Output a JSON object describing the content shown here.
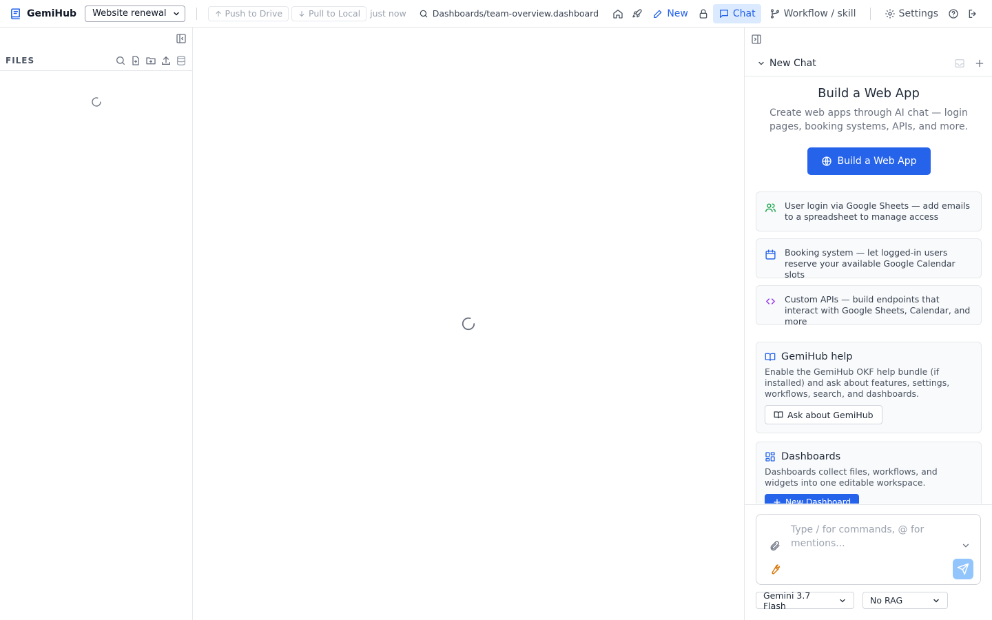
{
  "app": {
    "name": "GemiHub",
    "brand_color": "#2563eb"
  },
  "topbar": {
    "workspace": "Website renewal",
    "push_label": "Push to Drive",
    "pull_label": "Pull to Local",
    "sync_time": "just now",
    "file_path": "Dashboards/team-overview.dashboard",
    "new_label": "New",
    "chat_label": "Chat",
    "workflow_label": "Workflow / skill",
    "settings_label": "Settings"
  },
  "sidebar": {
    "title": "FILES"
  },
  "chat": {
    "title": "New Chat",
    "hero": {
      "title": "Build a Web App",
      "subtitle": "Create web apps through AI chat — login pages, booking systems, APIs, and more.",
      "button": "Build a Web App"
    },
    "features": [
      {
        "icon": "users-icon",
        "text": "User login via Google Sheets — add emails to a spreadsheet to manage access"
      },
      {
        "icon": "calendar-icon",
        "text": "Booking system — let logged-in users reserve your available Google Calendar slots"
      },
      {
        "icon": "code-icon",
        "text": "Custom APIs — build endpoints that interact with Google Sheets, Calendar, and more"
      }
    ],
    "help": {
      "title": "GemiHub help",
      "description": "Enable the GemiHub OKF help bundle (if installed) and ask about features, settings, workflows, search, and dashboards.",
      "button": "Ask about GemiHub"
    },
    "dashboards": {
      "title": "Dashboards",
      "description": "Dashboards collect files, workflows, and widgets into one editable workspace.",
      "button": "New Dashboard"
    },
    "input": {
      "placeholder": "Type / for commands, @ for mentions..."
    },
    "model": "Gemini 3.7 Flash",
    "rag": "No RAG"
  }
}
